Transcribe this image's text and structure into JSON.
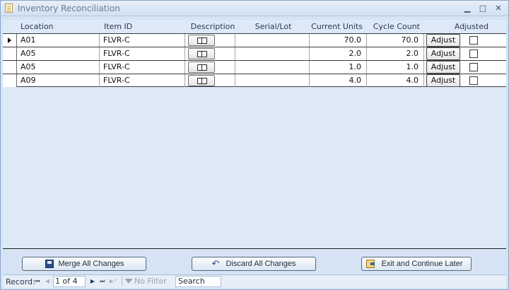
{
  "window": {
    "title": "Inventory Reconciliation",
    "controls": {
      "minimize": "▁",
      "maximize": "□",
      "close": "✕"
    }
  },
  "table": {
    "columns": {
      "location": "Location",
      "item_id": "Item ID",
      "description": "Description",
      "serial_lot": "Serial/Lot",
      "current_units": "Current Units",
      "cycle_count": "Cycle Count",
      "adjusted": "Adjusted"
    },
    "rows": [
      {
        "location": "A01",
        "item_id": "FLVR-C",
        "serial_lot": "",
        "current_units": "70.0",
        "cycle_count": "70.0",
        "adjust_label": "Adjust",
        "adjusted": false,
        "selected": true
      },
      {
        "location": "A05",
        "item_id": "FLVR-C",
        "serial_lot": "",
        "current_units": "2.0",
        "cycle_count": "2.0",
        "adjust_label": "Adjust",
        "adjusted": false,
        "selected": false
      },
      {
        "location": "A05",
        "item_id": "FLVR-C",
        "serial_lot": "",
        "current_units": "1.0",
        "cycle_count": "1.0",
        "adjust_label": "Adjust",
        "adjusted": false,
        "selected": false
      },
      {
        "location": "A09",
        "item_id": "FLVR-C",
        "serial_lot": "",
        "current_units": "4.0",
        "cycle_count": "4.0",
        "adjust_label": "Adjust",
        "adjusted": false,
        "selected": false
      }
    ]
  },
  "actions": {
    "merge": "Merge All Changes",
    "discard": "Discard All Changes",
    "exit": "Exit and Continue Later"
  },
  "navigation": {
    "record_label": "Record:",
    "position": "1 of 4",
    "filter": "No Filter",
    "search": "Search"
  },
  "colors": {
    "frame": "#d5e3f4",
    "grid_background": "#dde9f7",
    "row_border": "#3b3b3b"
  }
}
